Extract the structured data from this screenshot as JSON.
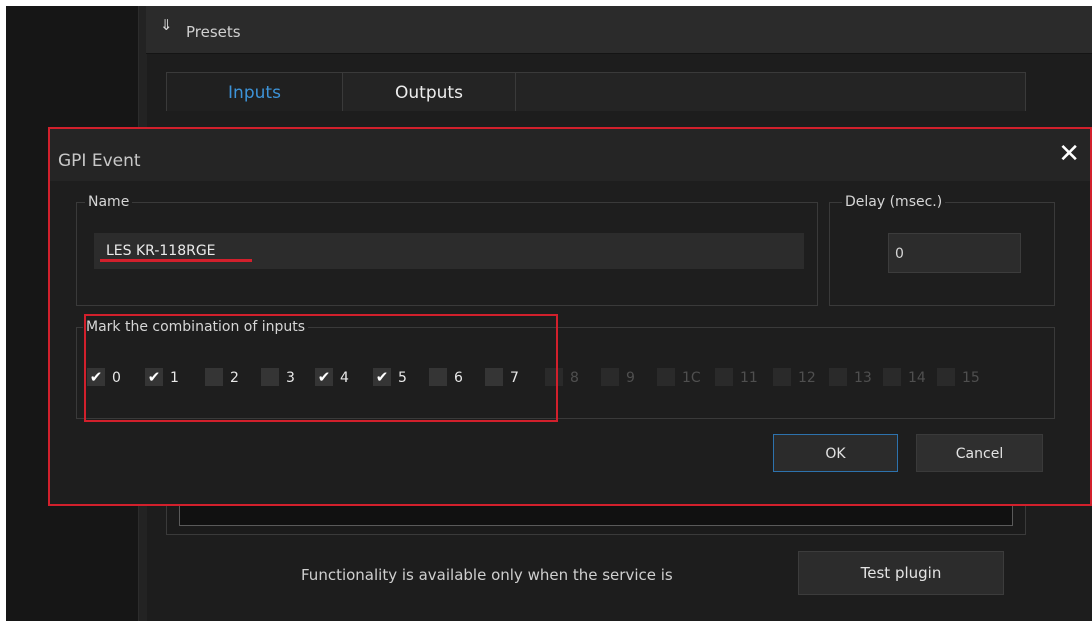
{
  "presets": {
    "icon": "double-chevron-down-icon",
    "label": "Presets"
  },
  "tabs": [
    {
      "label": "Inputs",
      "active": true
    },
    {
      "label": "Outputs",
      "active": false
    }
  ],
  "dialog": {
    "title": "GPI Event",
    "close_icon": "close-icon",
    "name": {
      "legend": "Name",
      "value": "LES KR-118RGE"
    },
    "delay": {
      "legend": "Delay (msec.)",
      "value": "0"
    },
    "combination": {
      "legend": "Mark the combination of inputs",
      "inputs": [
        {
          "label": "0",
          "checked": true,
          "enabled": true
        },
        {
          "label": "1",
          "checked": true,
          "enabled": true
        },
        {
          "label": "2",
          "checked": false,
          "enabled": true
        },
        {
          "label": "3",
          "checked": false,
          "enabled": true
        },
        {
          "label": "4",
          "checked": true,
          "enabled": true
        },
        {
          "label": "5",
          "checked": true,
          "enabled": true
        },
        {
          "label": "6",
          "checked": false,
          "enabled": true
        },
        {
          "label": "7",
          "checked": false,
          "enabled": true
        },
        {
          "label": "8",
          "checked": false,
          "enabled": false
        },
        {
          "label": "9",
          "checked": false,
          "enabled": false
        },
        {
          "label": "1C",
          "checked": false,
          "enabled": false
        },
        {
          "label": "11",
          "checked": false,
          "enabled": false
        },
        {
          "label": "12",
          "checked": false,
          "enabled": false
        },
        {
          "label": "13",
          "checked": false,
          "enabled": false
        },
        {
          "label": "14",
          "checked": false,
          "enabled": false
        },
        {
          "label": "15",
          "checked": false,
          "enabled": false
        }
      ]
    },
    "buttons": {
      "ok": "OK",
      "cancel": "Cancel"
    }
  },
  "footer": {
    "text": "Functionality is available only when the service is",
    "test_button": "Test plugin"
  },
  "colors": {
    "accent": "#3d93d8",
    "highlight": "#d2202c",
    "background": "#1d1d1d"
  }
}
